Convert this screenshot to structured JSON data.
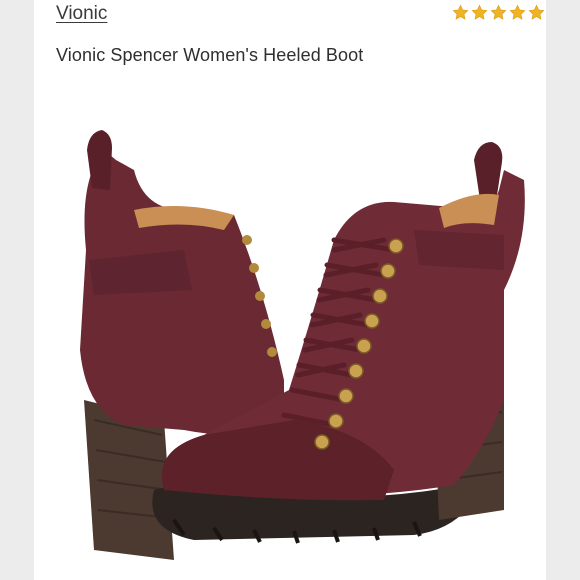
{
  "listing": {
    "brand": "Vionic",
    "title": "Vionic Spencer Women's Heeled Boot",
    "rating": 5,
    "rating_max": 5
  },
  "colors": {
    "star": "#f0b323",
    "boot": "#6e2b35",
    "sole": "#2e2622",
    "heel": "#4a3a32",
    "hardware": "#c9a14f"
  },
  "icons": {
    "star": "star-icon"
  }
}
